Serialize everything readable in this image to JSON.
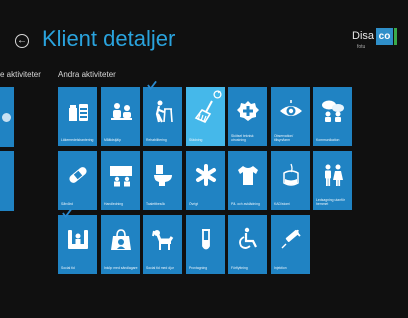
{
  "header": {
    "title": "Klient detaljer",
    "brand_text": "Disa",
    "brand_logo_text": "co",
    "brand_sub": "fotu"
  },
  "sections": {
    "left_label": "e aktiviteter",
    "right_label": "Andra aktiviteter"
  },
  "tiles": [
    {
      "label": "Läkemedelshantering",
      "icon": "medicine-icon",
      "checked": false,
      "selected": false
    },
    {
      "label": "Måltidstjälp",
      "icon": "meal-icon",
      "checked": false,
      "selected": false
    },
    {
      "label": "Rehabilitering",
      "icon": "walker-icon",
      "checked": true,
      "selected": false
    },
    {
      "label": "Städning",
      "icon": "broom-icon",
      "checked": false,
      "selected": true
    },
    {
      "label": "Skötsel teknisk utrustning",
      "icon": "technical-aid-icon",
      "checked": false,
      "selected": false
    },
    {
      "label": "Observation/ tillsyn/larm",
      "icon": "eye-icon",
      "checked": false,
      "selected": false
    },
    {
      "label": "Kommunikation",
      "icon": "conversation-icon",
      "checked": false,
      "selected": false
    },
    {
      "label": "Sårvård",
      "icon": "bandage-icon",
      "checked": false,
      "selected": false
    },
    {
      "label": "Handledning",
      "icon": "instruction-icon",
      "checked": false,
      "selected": false
    },
    {
      "label": "Toalettbesök",
      "icon": "toilet-icon",
      "checked": false,
      "selected": false
    },
    {
      "label": "Övrigt",
      "icon": "asterisk-icon",
      "checked": false,
      "selected": false
    },
    {
      "label": "På- och avklädning",
      "icon": "shirt-icon",
      "checked": false,
      "selected": false
    },
    {
      "label": "KAD/stomi",
      "icon": "catheter-bag-icon",
      "checked": false,
      "selected": false
    },
    {
      "label": "Ledsagning utanför hemmet",
      "icon": "escort-icon",
      "checked": false,
      "selected": false
    },
    {
      "label": "Social tid",
      "icon": "social-time-icon",
      "checked": true,
      "selected": false
    },
    {
      "label": "Inköp med sändlagare",
      "icon": "shopping-bag-icon",
      "checked": false,
      "selected": false
    },
    {
      "label": "Social tid med djur",
      "icon": "dog-icon",
      "checked": false,
      "selected": false
    },
    {
      "label": "Provtagning",
      "icon": "test-tube-icon",
      "checked": false,
      "selected": false
    },
    {
      "label": "Förflyttning",
      "icon": "wheelchair-icon",
      "checked": false,
      "selected": false
    },
    {
      "label": "Injektion",
      "icon": "syringe-icon",
      "checked": false,
      "selected": false
    }
  ],
  "colors": {
    "tile": "#2083c3",
    "tile_selected": "#45b8ea",
    "title": "#2aa3dd",
    "background": "#101010"
  }
}
